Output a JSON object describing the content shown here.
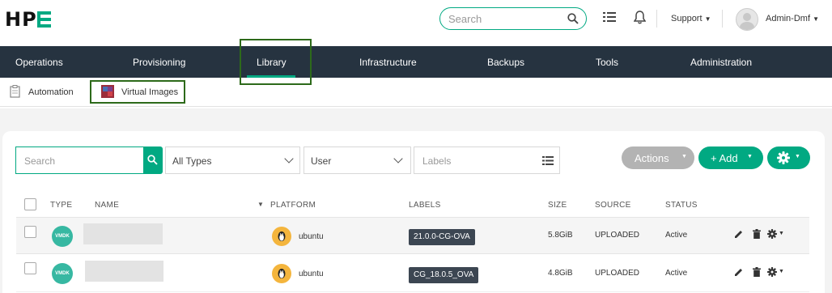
{
  "header": {
    "logo_text": "HP",
    "search_placeholder": "Search",
    "support_label": "Support",
    "user_label": "Admin-Dmf"
  },
  "main_nav": [
    {
      "label": "Operations"
    },
    {
      "label": "Provisioning"
    },
    {
      "label": "Library",
      "active": true
    },
    {
      "label": "Infrastructure"
    },
    {
      "label": "Backups"
    },
    {
      "label": "Tools"
    },
    {
      "label": "Administration"
    }
  ],
  "sub_nav": [
    {
      "label": "Automation"
    },
    {
      "label": "Virtual Images",
      "active": true
    }
  ],
  "filters": {
    "search_placeholder": "Search",
    "type_value": "All Types",
    "owner_value": "User",
    "labels_placeholder": "Labels"
  },
  "buttons": {
    "actions": "Actions",
    "add": "+ Add"
  },
  "table": {
    "columns": [
      "TYPE",
      "NAME",
      "PLATFORM",
      "LABELS",
      "SIZE",
      "SOURCE",
      "STATUS"
    ],
    "rows": [
      {
        "type": "VMDK",
        "name": "",
        "platform": "ubuntu",
        "label": "21.0.0-CG-OVA",
        "size": "5.8GiB",
        "source": "UPLOADED",
        "status": "Active"
      },
      {
        "type": "VMDK",
        "name": "",
        "platform": "ubuntu",
        "label": "CG_18.0.5_OVA",
        "size": "4.8GiB",
        "source": "UPLOADED",
        "status": "Active"
      }
    ]
  },
  "colors": {
    "brand": "#01a982",
    "nav_bg": "#263340",
    "highlight_box": "#2d6a1a",
    "badge_bg": "#3c4652",
    "actions_btn": "#b3b3b3"
  }
}
